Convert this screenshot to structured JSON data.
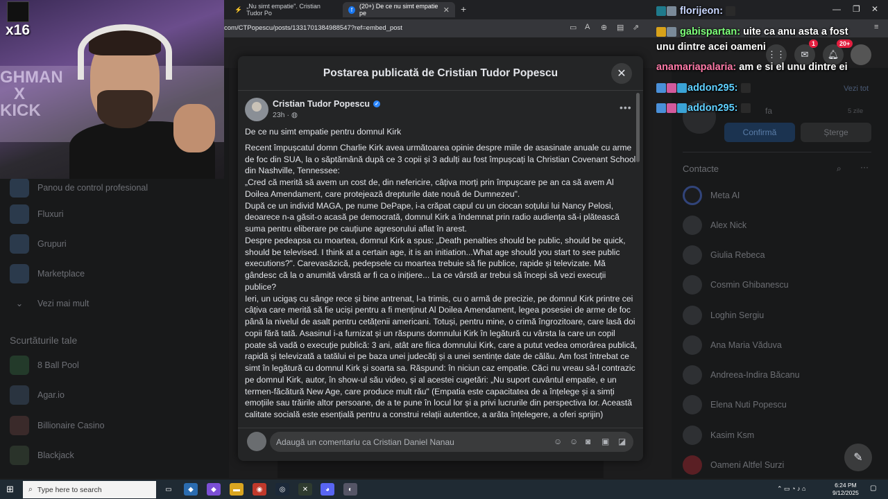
{
  "browser": {
    "tabs": [
      {
        "label": "„Nu simt empatie\". Cristian Tudor Po"
      },
      {
        "label": "(20+) De ce nu simt empatie pe"
      }
    ],
    "url": "com/CTPopescu/posts/1331701384988547?ref=embed_post"
  },
  "modal": {
    "title": "Postarea publicată de Cristian Tudor Popescu",
    "author": "Cristian Tudor Popescu",
    "time": "23h",
    "post_title": "De ce nu simt empatie pentru domnul Kirk",
    "paragraphs": [
      " Recent împușcatul domn Charlie Kirk avea următoarea opinie despre miile de asasinate anuale cu arme de foc din SUA, la o săptămână după ce 3 copii și 3 adulți au fost împușcați la Christian Covenant School din Nashville, Tennessee:",
      " „Cred că merită să avem un cost de, din nefericire, câțiva morți prin împușcare pe an ca să avem Al Doilea Amendament, care protejează drepturile date nouă de Dumnezeu\".",
      " După ce un individ MAGA, pe nume DePape, i-a crăpat capul cu un ciocan soțului lui Nancy Pelosi, deoarece n-a găsit-o acasă pe democrată, domnul Kirk a îndemnat prin radio audiența să-i plătească suma pentru eliberare pe cauțiune agresorului aflat în arest.",
      " Despre pedeapsa cu moartea, domnul Kirk a spus: „Death penalties should be public, should be quick, should be televised. I think at a certain age, it is an initiation...What age should you start to see public executions?\". Carevasăzică, pedepsele cu moartea trebuie să fie publice, rapide și televizate. Mă gândesc că la o anumită vârstă ar fi ca o inițiere... La ce vârstă ar trebui să începi să vezi execuții publice?",
      " Ieri, un ucigaș cu sânge rece și bine antrenat, l-a trimis, cu o armă de precizie, pe domnul Kirk printre cei câțiva care merită să fie uciși pentru a fi menținut Al Doilea Amendament, legea posesiei de arme de foc până la nivelul de asalt pentru cetățenii americani. Totuși, pentru mine, o crimă îngrozitoare, care lasă doi copii fără tată. Asasinul i-a furnizat și un răspuns domnului Kirk în legătură cu vârsta la care un copil poate să vadă o execuție publică: 3 ani, atât are fiica domnului Kirk, care a putut vedea omorârea publică, rapidă și televizată a tatălui ei pe baza unei judecăți și a unei sentințe date de călău. Am fost întrebat ce simt în legătură cu domnul Kirk și soarta sa. Răspund: în niciun caz empatie. Căci nu vreau să-l contrazic pe domnul Kirk, autor, în show-ul său video, și al acestei cugetări: „Nu suport cuvântul empatie, e un termen-făcătură New Age, care produce mult rău\" (Empatia este capacitatea de a înțelege și a simți emoțiile sau trăirile altor persoane, de a te pune în locul lor și a privi lucrurile din perspectiva lor. Această calitate socială este esențială pentru a construi relații autentice, a arăta înțelegere, a oferi sprijin)"
    ],
    "comment_placeholder": "Adaugă un comentariu ca Cristian Daniel Nanau"
  },
  "left_sidebar": {
    "items": [
      "Panou de control profesional",
      "Fluxuri",
      "Grupuri",
      "Marketplace",
      "Vezi mai mult"
    ],
    "shortcuts_title": "Scurtăturile tale",
    "shortcuts": [
      "8 Ball Pool",
      "Agar.io",
      "Billionaire Casino",
      "Blackjack"
    ]
  },
  "right_sidebar": {
    "see_all": "Vezi tot",
    "friend_request_fragment": "fa",
    "friend_request_time": "5 zile",
    "confirm_label": "Confirmă",
    "delete_label": "Șterge",
    "contacts_title": "Contacte",
    "contacts": [
      "Meta AI",
      "Alex Nick",
      "Giulia Rebeca",
      "Cosmin Ghibanescu",
      "Loghin Sergiu",
      "Ana Maria Văduva",
      "Andreea-Indira Băcanu",
      "Elena Nuti Popescu",
      "Kasim Ksm",
      "Oameni Altfel Surzi"
    ],
    "badges": {
      "messenger": "1",
      "notifications": "20+"
    }
  },
  "stream": {
    "counter": "x16",
    "overlay_text_1": "GHMAN",
    "overlay_text_2": "X",
    "overlay_text_3": "KICK",
    "chat": [
      {
        "user": "florijeon:",
        "msg": ""
      },
      {
        "user": "gabispartan:",
        "msg": "uite ca anu asta a fost unu dintre acei oameni"
      },
      {
        "user": "anamariapalaria:",
        "msg": "am e si el unu dintre ei"
      },
      {
        "user": "addon295:",
        "msg": ""
      },
      {
        "user": "addon295:",
        "msg": ""
      }
    ]
  },
  "taskbar": {
    "search_placeholder": "Type here to search",
    "time": "6:24 PM",
    "date": "9/12/2025"
  },
  "colors": {
    "accent": "#2d88ff",
    "modal_bg": "#242526",
    "badge": "#e41e3f"
  }
}
